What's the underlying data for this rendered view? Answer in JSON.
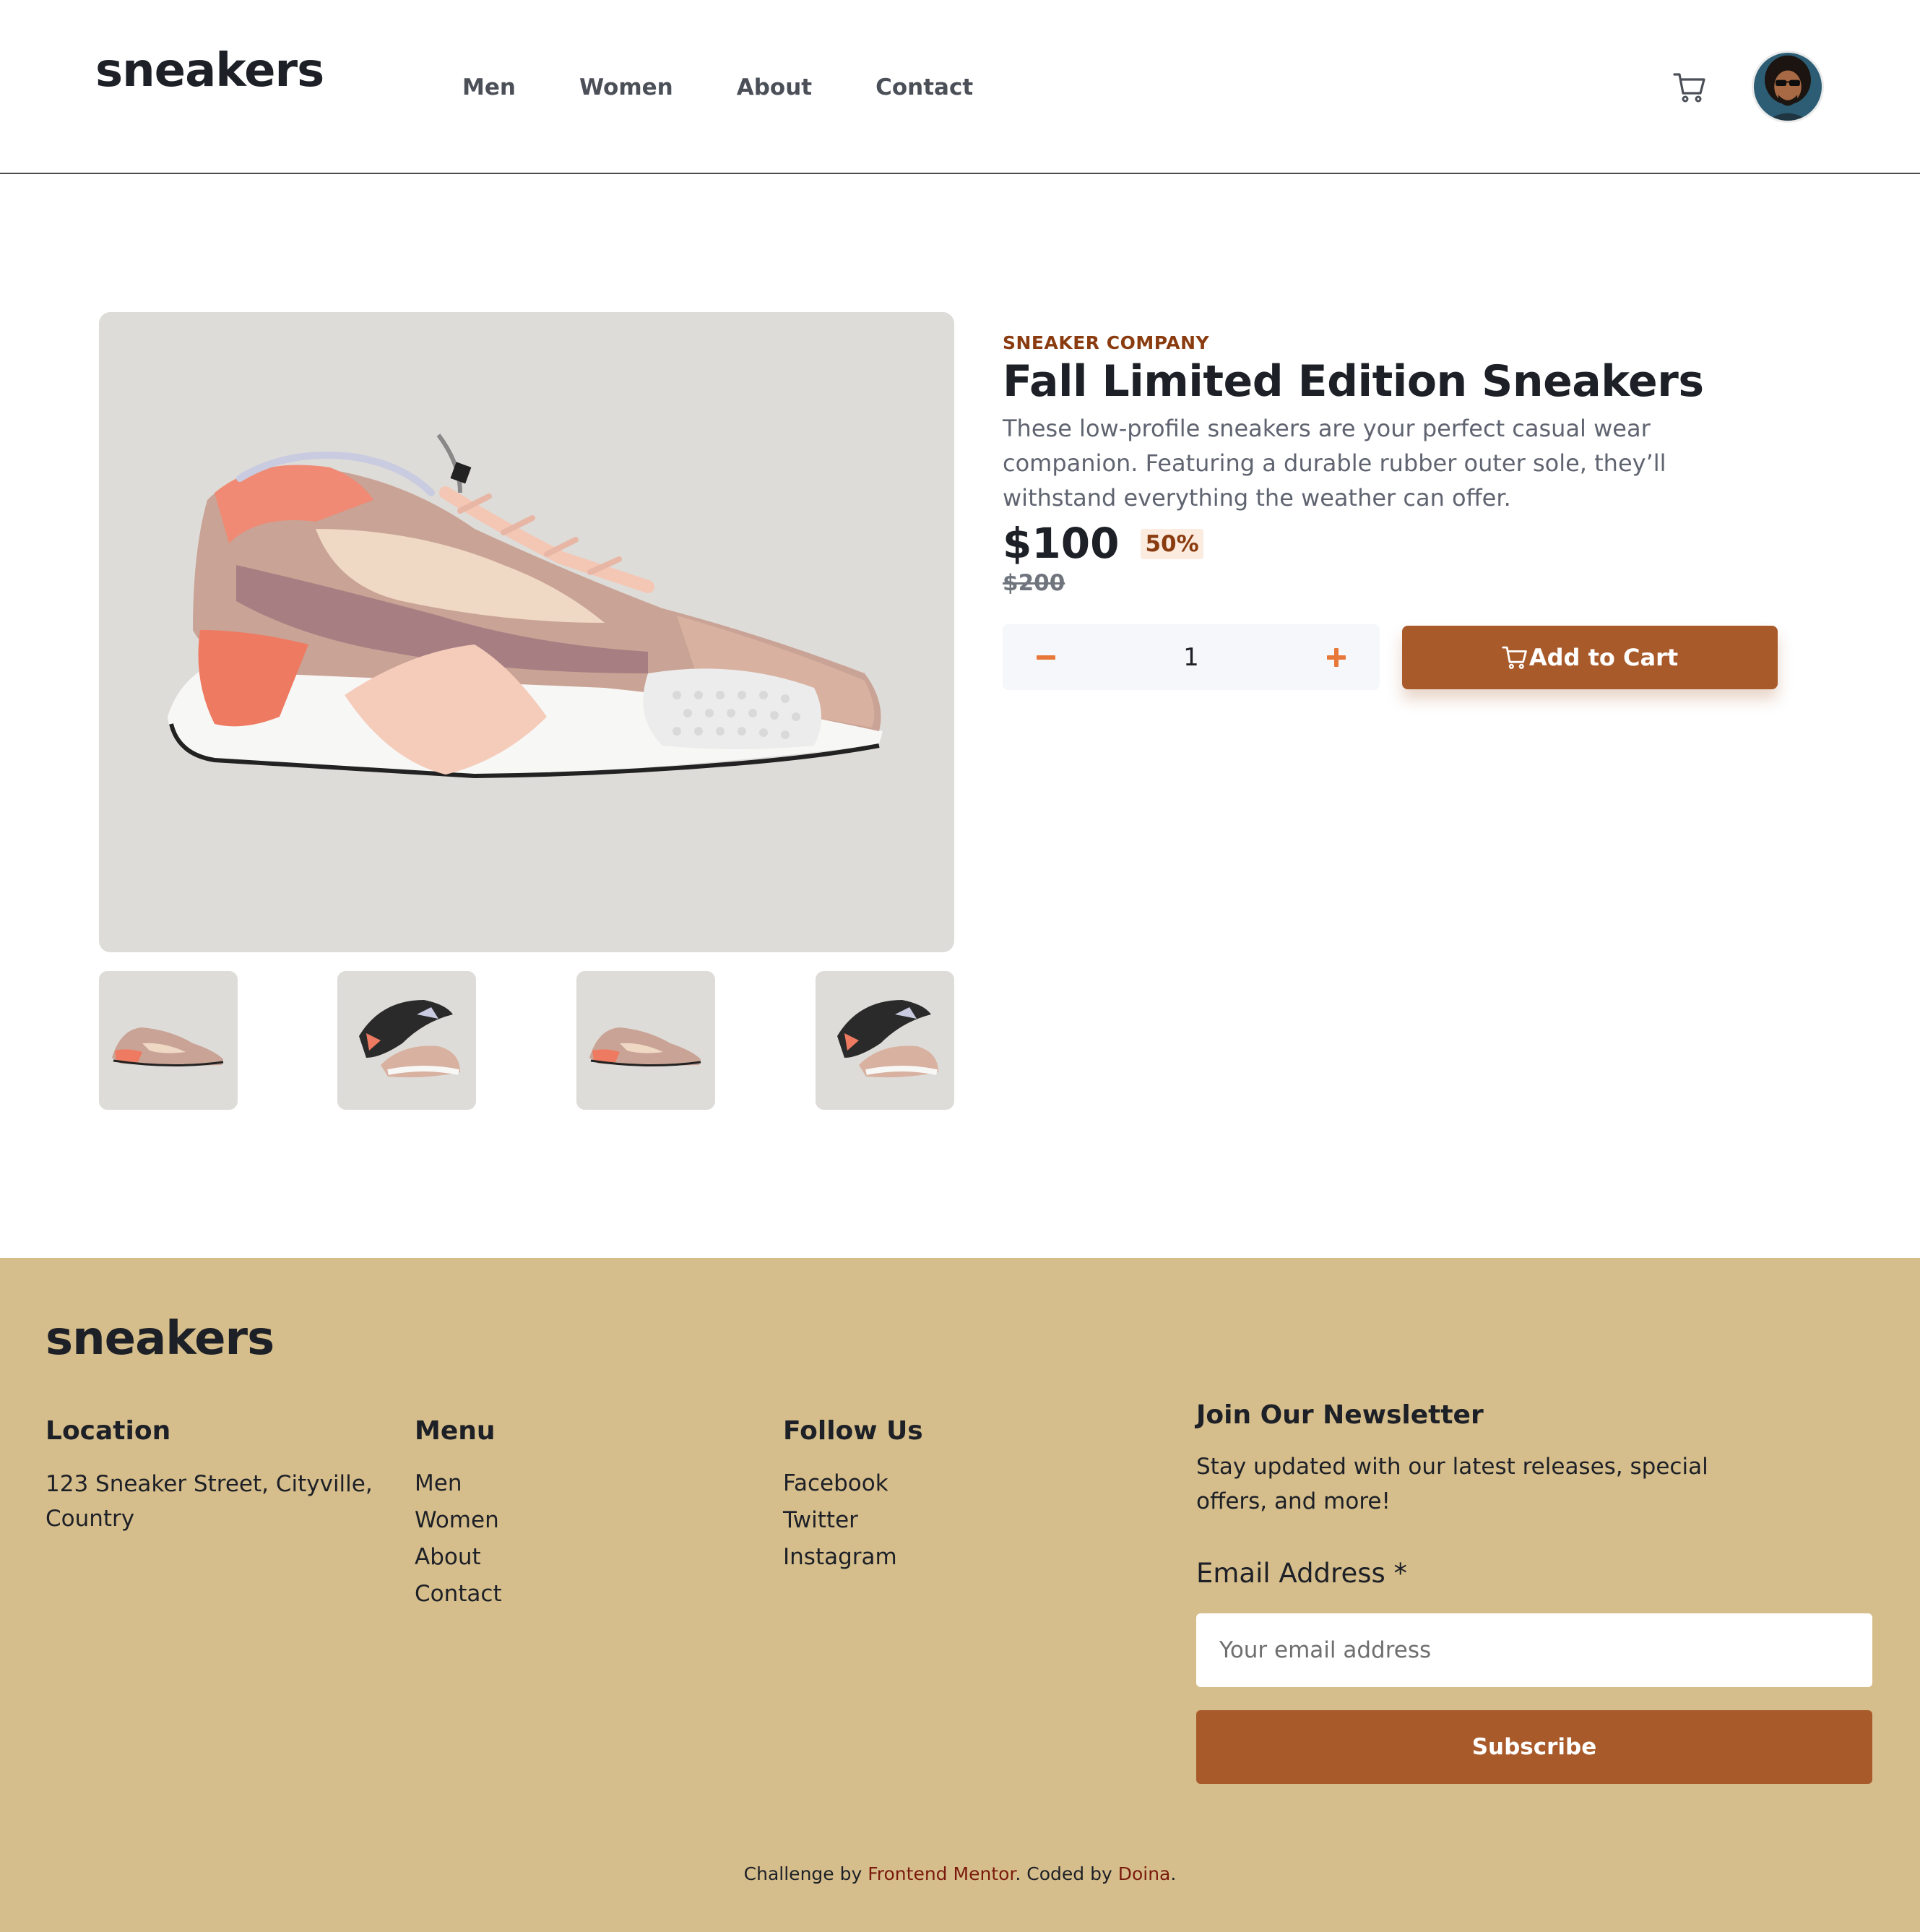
{
  "header": {
    "logo": "sneakers",
    "nav": [
      "Men",
      "Women",
      "About",
      "Contact"
    ]
  },
  "product": {
    "company": "SNEAKER COMPANY",
    "title": "Fall Limited Edition Sneakers",
    "description": "These low-profile sneakers are your perfect casual wear companion. Featuring a durable rubber outer sole, they’ll withstand everything the weather can offer.",
    "price": "$100",
    "discount": "50%",
    "old_price": "$200",
    "quantity": "1",
    "add_to_cart": "Add to Cart"
  },
  "footer": {
    "logo": "sneakers",
    "location": {
      "heading": "Location",
      "address": "123 Sneaker Street, Cityville, Country"
    },
    "menu": {
      "heading": "Menu",
      "items": [
        "Men",
        "Women",
        "About",
        "Contact"
      ]
    },
    "follow": {
      "heading": "Follow Us",
      "items": [
        "Facebook",
        "Twitter",
        "Instagram"
      ]
    },
    "newsletter": {
      "heading": "Join Our Newsletter",
      "text": "Stay updated with our latest releases, special offers, and more!",
      "email_label": "Email Address *",
      "email_placeholder": "Your email address",
      "subscribe": "Subscribe"
    },
    "credit": {
      "prefix": "Challenge by ",
      "link1": "Frontend Mentor",
      "middle": ". Coded by ",
      "link2": "Doina",
      "suffix": "."
    }
  },
  "colors": {
    "accent": "#a95a2a",
    "accent_plus": "#e8783a",
    "brand_text": "#8a3c10",
    "footer_bg": "#d6be8c",
    "image_bg": "#dedcd8"
  },
  "icons": [
    "cart-icon",
    "avatar",
    "minus-icon",
    "plus-icon",
    "cart-icon"
  ]
}
